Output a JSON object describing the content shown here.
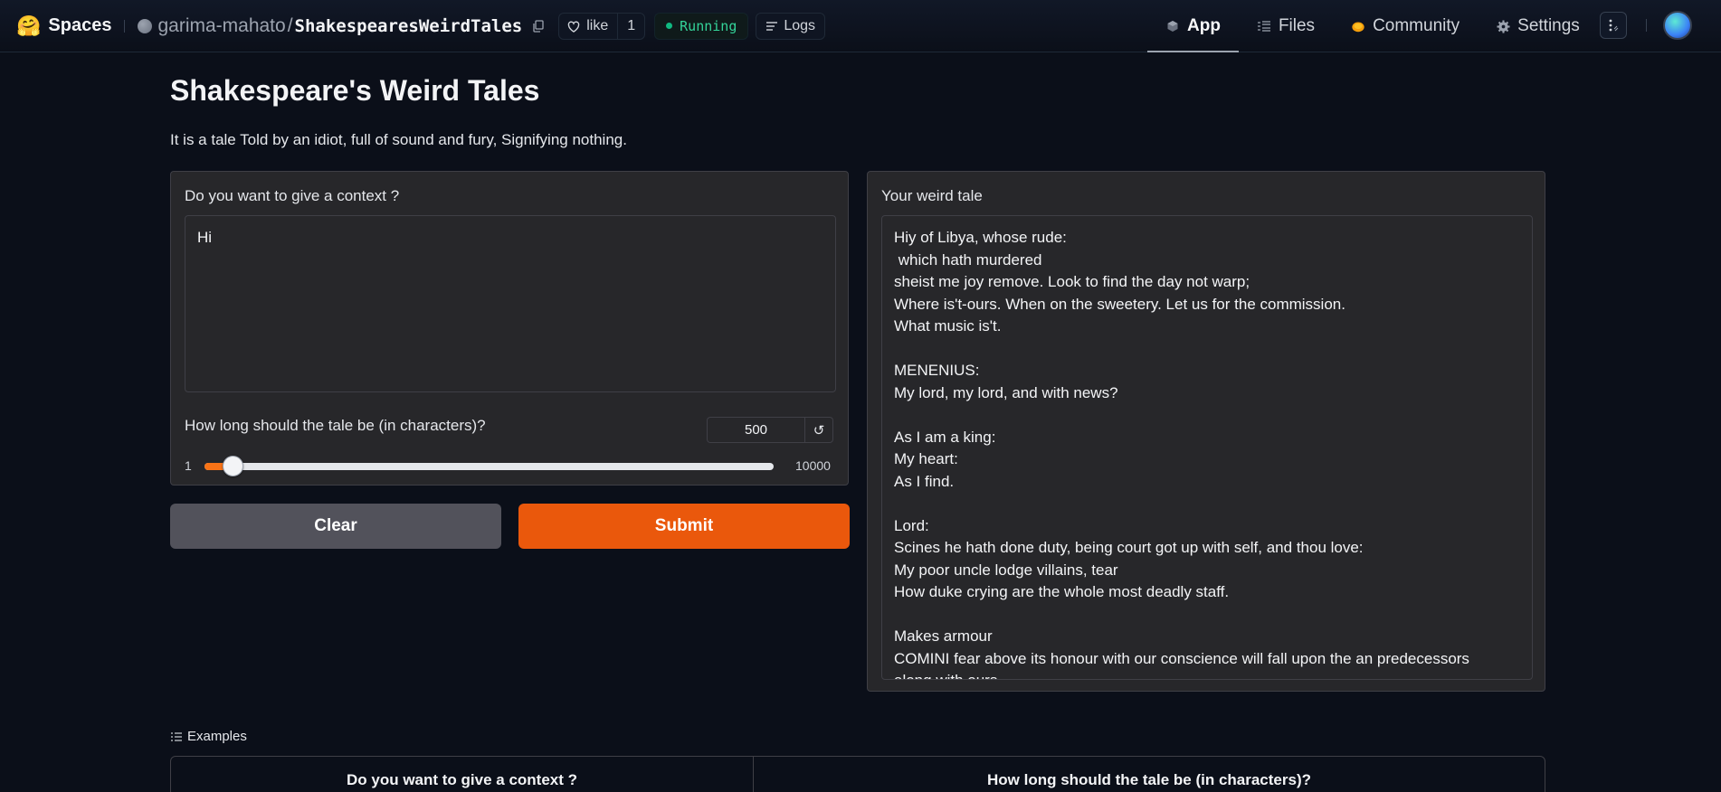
{
  "nav": {
    "brand": "Spaces",
    "owner": "garima-mahato",
    "repo": "ShakespearesWeirdTales",
    "like_label": "like",
    "like_count": "1",
    "status": "Running",
    "logs_label": "Logs",
    "tabs": [
      {
        "label": "App",
        "icon": "cube-icon",
        "active": true
      },
      {
        "label": "Files",
        "icon": "files-icon",
        "active": false
      },
      {
        "label": "Community",
        "icon": "community-icon",
        "active": false
      },
      {
        "label": "Settings",
        "icon": "gear-icon",
        "active": false
      }
    ]
  },
  "app": {
    "title": "Shakespeare's Weird Tales",
    "description": "It is a tale Told by an idiot, full of sound and fury, Signifying nothing.",
    "context_label": "Do you want to give a context ?",
    "context_value": "Hi",
    "length_label": "How long should the tale be (in characters)?",
    "length_value": "500",
    "slider": {
      "min": "1",
      "max": "10000",
      "value": 500
    },
    "clear_label": "Clear",
    "submit_label": "Submit",
    "output_label": "Your weird tale",
    "output_text": "Hiy of Libya, whose rude:\n which hath murdered\nsheist me joy remove. Look to find the day not warp;\nWhere is't-ours. When on the sweetery. Let us for the commission.\nWhat music is't.\n\nMENENIUS:\nMy lord, my lord, and with news?\n\nAs I am a king:\nMy heart:\nAs I find.\n\nLord:\nScines he hath done duty, being court got up with self, and thou love:\nMy poor uncle lodge villains, tear\nHow duke crying are the whole most deadly staff.\n\nMakes armour\nCOMINI fear above its honour with our conscience will fall upon the an predecessors\nalong with ours"
  },
  "examples": {
    "label": "Examples",
    "headers": [
      "Do you want to give a context ?",
      "How long should the tale be (in characters)?"
    ]
  },
  "colors": {
    "accent": "#ea580c",
    "running": "#10b981",
    "background": "#0b0f19",
    "panel": "#27272a"
  }
}
